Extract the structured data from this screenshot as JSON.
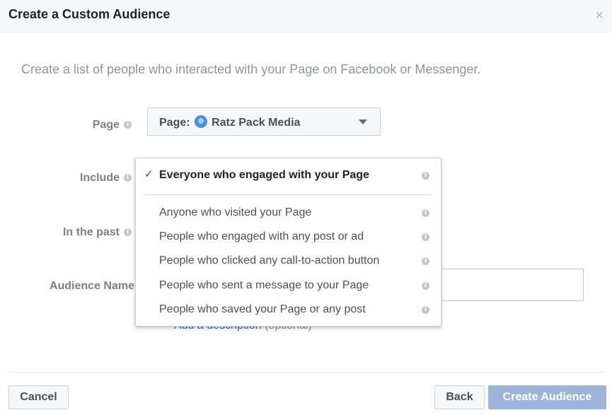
{
  "dialog": {
    "title": "Create a Custom Audience",
    "close_symbol": "×",
    "intro": "Create a list of people who interacted with your Page on Facebook or Messenger."
  },
  "fields": {
    "page_label": "Page",
    "include_label": "Include",
    "in_past_label": "In the past",
    "audience_name_label": "Audience Name"
  },
  "page_select": {
    "prefix": "Page:",
    "value": "Ratz Pack Media"
  },
  "description_link": {
    "link": "Add a description",
    "optional": "(optional)"
  },
  "include_dropdown": {
    "selected": "Everyone who engaged with your Page",
    "options": [
      "Anyone who visited your Page",
      "People who engaged with any post or ad",
      "People who clicked any call-to-action button",
      "People who sent a message to your Page",
      "People who saved your Page or any post"
    ]
  },
  "buttons": {
    "cancel": "Cancel",
    "back": "Back",
    "create": "Create Audience"
  },
  "colors": {
    "link": "#4267b2",
    "create_button_disabled": "#9cb4d8",
    "label_gray": "#7f7f7f"
  }
}
